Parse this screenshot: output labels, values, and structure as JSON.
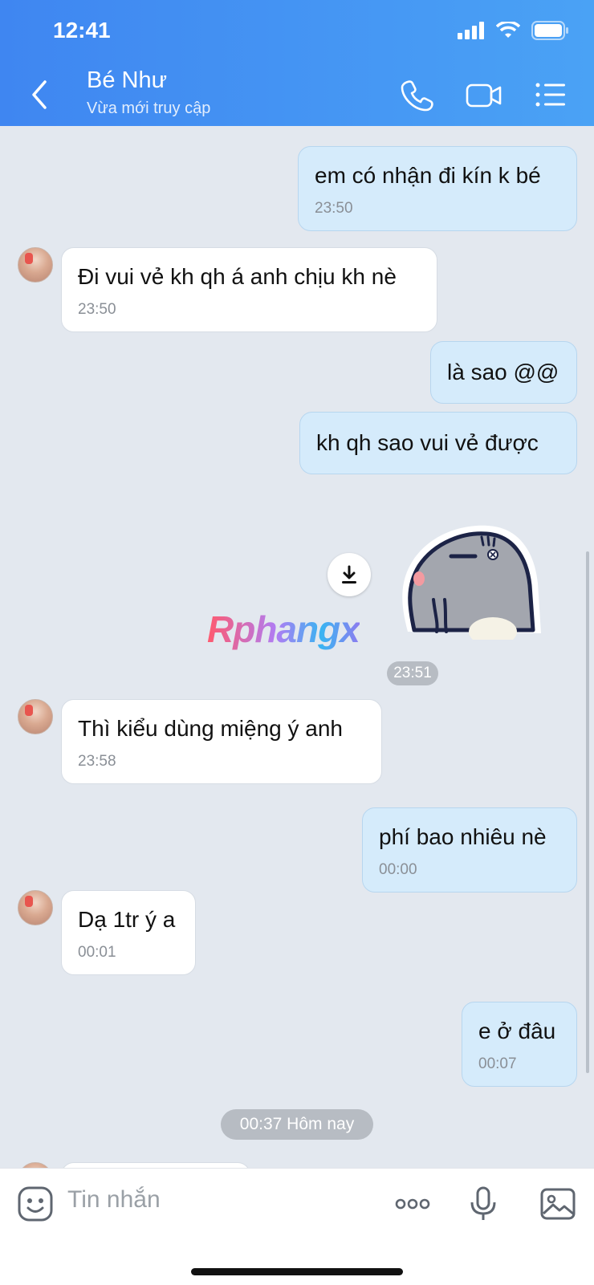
{
  "status_bar": {
    "time": "12:41"
  },
  "header": {
    "name": "Bé Như",
    "status": "Vừa mới truy cập",
    "colors": {
      "gradient_start": "#3f86f1",
      "gradient_end": "#4aa2f5"
    }
  },
  "messages": [
    {
      "from": "me",
      "text": "em có nhận đi kín k bé",
      "time": "23:50"
    },
    {
      "from": "them",
      "text": "Đi vui vẻ kh qh á anh chịu kh nè",
      "time": "23:50"
    },
    {
      "from": "me",
      "text": "là sao @@",
      "time": ""
    },
    {
      "from": "me",
      "text": "kh qh sao vui vẻ được",
      "time": ""
    },
    {
      "from": "me",
      "type": "sticker",
      "sticker": "grey-seal-sticker"
    },
    {
      "from": "them",
      "text": "Thì kiểu dùng miệng ý anh",
      "time": "23:58"
    },
    {
      "from": "me",
      "text": "phí bao nhiêu nè",
      "time": "00:00"
    },
    {
      "from": "them",
      "text": "Dạ 1tr ý a",
      "time": "00:01"
    },
    {
      "from": "me",
      "text": "e ở đâu",
      "time": "00:07"
    }
  ],
  "sticker_time": "23:51",
  "date_divider": "00:37 Hôm nay",
  "watermark": "Rphangx",
  "input": {
    "placeholder": "Tin nhắn"
  },
  "icons": {
    "back": "chevron-left-icon",
    "call": "phone-icon",
    "video": "video-camera-icon",
    "menu": "list-menu-icon",
    "emoji": "emoji-icon",
    "more": "more-dots-icon",
    "mic": "microphone-icon",
    "image": "image-icon",
    "download": "download-icon"
  },
  "colors": {
    "bubble_out": "#d5ebfb",
    "bubble_in": "#ffffff",
    "chat_bg": "#e3e8ef"
  }
}
